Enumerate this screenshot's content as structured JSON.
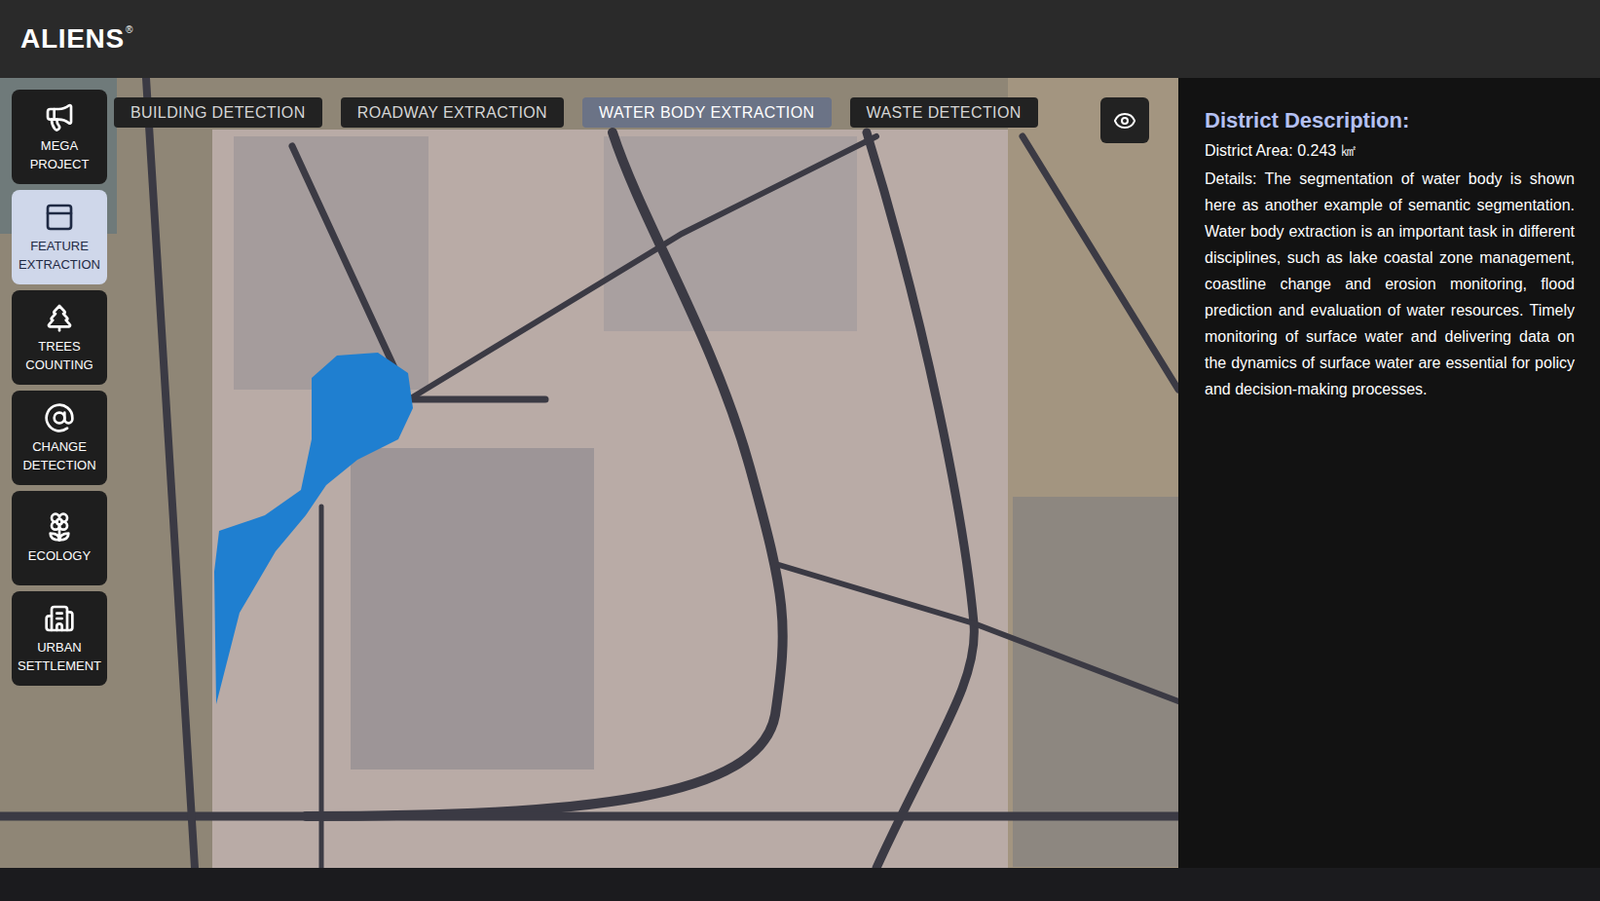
{
  "header": {
    "logo": "ALIENS",
    "logo_mark": "®"
  },
  "sidebar": {
    "items": [
      {
        "label_lines": [
          "MEGA",
          "PROJECT"
        ],
        "selected": false
      },
      {
        "label_lines": [
          "FEATURE",
          "EXTRACTION"
        ],
        "selected": true
      },
      {
        "label_lines": [
          "TREES",
          "COUNTING"
        ],
        "selected": false
      },
      {
        "label_lines": [
          "CHANGE",
          "DETECTION"
        ],
        "selected": false
      },
      {
        "label_lines": [
          "ECOLOGY"
        ],
        "selected": false
      },
      {
        "label_lines": [
          "URBAN",
          "SETTLEMENT"
        ],
        "selected": false
      }
    ]
  },
  "tabs": [
    {
      "label": "BUILDING DETECTION",
      "selected": false
    },
    {
      "label": "ROADWAY EXTRACTION",
      "selected": false
    },
    {
      "label": "WATER BODY EXTRACTION",
      "selected": true
    },
    {
      "label": "WASTE DETECTION",
      "selected": false
    }
  ],
  "panel": {
    "title": "District Description:",
    "area": "District Area: 0.243 ㎢",
    "details": "Details: The segmentation of water body is shown here as another example of semantic segmentation. Water body extraction is an important task in different disciplines, such as lake coastal zone management, coastline change and erosion monitoring, flood prediction and evaluation of water resources. Timely monitoring of surface water and delivering data on the dynamics of surface water are essential for policy and decision-making processes."
  }
}
